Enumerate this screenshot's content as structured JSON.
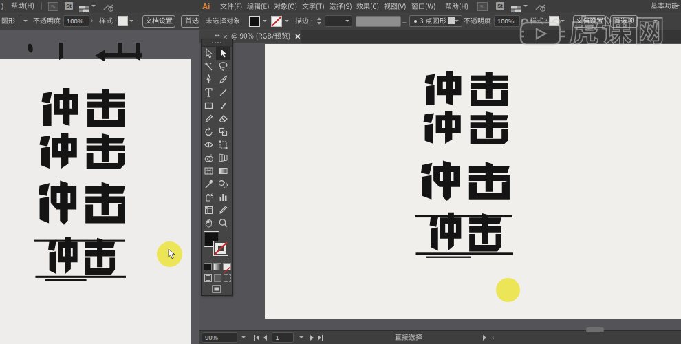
{
  "app": {
    "name": "Adobe Illustrator",
    "theme_dark": "#3f3f3f",
    "accent_orange": "#e0822e",
    "highlight_yellow": "#ede95e"
  },
  "left_window": {
    "menubar": {
      "fragment": ")",
      "help": "帮助(H)",
      "icons": [
        "bridge-icon",
        "stock-icon",
        "layout-icon",
        "sync-icon"
      ]
    },
    "controlbar": {
      "brush_fragment": "圆形",
      "opacity_label": "不透明度 :",
      "opacity_value": "100%",
      "style_label": "样式 :",
      "doc_setup": "文档设置",
      "preferences": "首选"
    },
    "artboard": {
      "logos": [
        "冲击",
        "冲击",
        "冲击",
        "冲击"
      ]
    }
  },
  "right_window": {
    "menubar": {
      "logo": "Ai",
      "menus": [
        "文件(F)",
        "编辑(E)",
        "对象(O)",
        "文字(T)",
        "选择(S)",
        "效果(C)",
        "视图(V)",
        "窗口(W)",
        "帮助(H)"
      ],
      "menu_ids": [
        "file",
        "edit",
        "object",
        "type",
        "select",
        "effect",
        "view",
        "window",
        "help"
      ],
      "menu_x": [
        0,
        39,
        78,
        119,
        159,
        198,
        238,
        278,
        327
      ],
      "workspace": "基本功能"
    },
    "controlbar": {
      "no_selection": "未选择对象",
      "stroke_label": "描边 :",
      "brush_name": "3 点圆形",
      "opacity_label": "不透明度 :",
      "opacity_value": "100%",
      "style_label": "样式 :",
      "doc_setup": "文档设置",
      "preferences": "首选项"
    },
    "doc_tab": {
      "prefix": "**",
      "title": "@ 90% (RGB/预览)"
    },
    "toolbar": {
      "tools": [
        {
          "id": "selection",
          "icon": "arrow-outline",
          "active": false
        },
        {
          "id": "direct-selection",
          "icon": "arrow-filled",
          "active": true
        },
        {
          "id": "magic-wand",
          "icon": "magic-wand",
          "active": false
        },
        {
          "id": "lasso",
          "icon": "lasso",
          "active": false
        },
        {
          "id": "pen",
          "icon": "pen-nib",
          "active": false
        },
        {
          "id": "ink-brush",
          "icon": "ink-pen",
          "active": false
        },
        {
          "id": "type",
          "icon": "type",
          "active": false
        },
        {
          "id": "line-segment",
          "icon": "line",
          "active": false
        },
        {
          "id": "rectangle",
          "icon": "rectangle",
          "active": false
        },
        {
          "id": "paintbrush",
          "icon": "brush",
          "active": false
        },
        {
          "id": "pencil",
          "icon": "pencil",
          "active": false
        },
        {
          "id": "eraser",
          "icon": "eraser",
          "active": false
        },
        {
          "id": "rotate",
          "icon": "rotate",
          "active": false
        },
        {
          "id": "scale",
          "icon": "scale",
          "active": false
        },
        {
          "id": "width",
          "icon": "width",
          "active": false
        },
        {
          "id": "free-transform",
          "icon": "free-transform",
          "active": false
        },
        {
          "id": "shape-builder",
          "icon": "shape-builder",
          "active": false
        },
        {
          "id": "perspective-grid",
          "icon": "perspective",
          "active": false
        },
        {
          "id": "mesh",
          "icon": "mesh",
          "active": false
        },
        {
          "id": "gradient",
          "icon": "gradient",
          "active": false
        },
        {
          "id": "eyedropper",
          "icon": "eyedropper",
          "active": false
        },
        {
          "id": "blend",
          "icon": "blend",
          "active": false
        },
        {
          "id": "symbol-sprayer",
          "icon": "symbol",
          "active": false
        },
        {
          "id": "column-graph",
          "icon": "graph",
          "active": false
        },
        {
          "id": "artboard",
          "icon": "artboard",
          "active": false
        },
        {
          "id": "slice",
          "icon": "slice",
          "active": false
        },
        {
          "id": "hand",
          "icon": "hand",
          "active": false
        },
        {
          "id": "zoom",
          "icon": "zoom",
          "active": false
        }
      ]
    },
    "statusbar": {
      "zoom": "90%",
      "artboard_num": "1",
      "tool": "直接选择"
    },
    "artboard": {
      "logos": [
        "冲击",
        "冲击",
        "冲击",
        "冲击"
      ]
    }
  },
  "watermark": {
    "text": "虎课网",
    "logo": "hukewang-play-icon"
  }
}
